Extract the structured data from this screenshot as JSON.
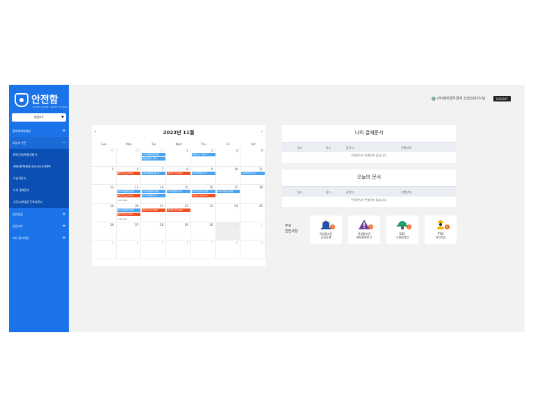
{
  "app": {
    "name": "안전함",
    "tagline": "SAFETY HOUSE · SAFETY SYSTEM"
  },
  "site_select": {
    "value": "현장A-1"
  },
  "header": {
    "user": "(주)정비결우결계 신성민(615)님",
    "logout": "LOGOUT"
  },
  "sidebar": {
    "items": [
      {
        "label": "중대재해처벌법"
      },
      {
        "label": "오늘의 안전"
      },
      {
        "label": "안전점검"
      },
      {
        "label": "안전교육"
      },
      {
        "label": "기타 관리사항"
      }
    ],
    "sub_items": [
      {
        "label": "DSC일일위험성평가"
      },
      {
        "label": "AI현대P위해재 체크리스트/OPS"
      },
      {
        "label": "오늘의문서"
      },
      {
        "label": "나의 결재문서"
      },
      {
        "label": "신규/고위험군근로자관리"
      }
    ]
  },
  "calendar": {
    "title": "2023년 11월",
    "prev": "‹",
    "next": "›",
    "weekdays": [
      "Sun",
      "Mon",
      "Tue",
      "Wed",
      "Thu",
      "Fri",
      "Sat"
    ],
    "weeks": [
      {
        "days": [
          [
            "29",
            "m"
          ],
          [
            "30",
            "m"
          ],
          [
            "31",
            "m"
          ],
          [
            "1",
            ""
          ],
          [
            "2",
            ""
          ],
          [
            "3",
            ""
          ],
          [
            "4",
            ""
          ]
        ]
      },
      {
        "days": [
          [
            "5",
            ""
          ],
          [
            "6",
            ""
          ],
          [
            "7",
            ""
          ],
          [
            "8",
            ""
          ],
          [
            "9",
            ""
          ],
          [
            "10",
            ""
          ],
          [
            "11",
            ""
          ]
        ]
      },
      {
        "days": [
          [
            "12",
            ""
          ],
          [
            "13",
            ""
          ],
          [
            "14",
            ""
          ],
          [
            "15",
            ""
          ],
          [
            "16",
            ""
          ],
          [
            "17",
            ""
          ],
          [
            "18",
            ""
          ]
        ]
      },
      {
        "days": [
          [
            "19",
            ""
          ],
          [
            "20",
            ""
          ],
          [
            "21",
            ""
          ],
          [
            "22",
            ""
          ],
          [
            "23",
            ""
          ],
          [
            "24",
            ""
          ],
          [
            "25",
            ""
          ]
        ]
      },
      {
        "days": [
          [
            "26",
            ""
          ],
          [
            "27",
            ""
          ],
          [
            "28",
            ""
          ],
          [
            "29",
            ""
          ],
          [
            "30",
            ""
          ],
          [
            "1",
            "m"
          ],
          [
            "2",
            "m"
          ]
        ]
      },
      {
        "days": [
          [
            "3",
            "m"
          ],
          [
            "4",
            "m"
          ],
          [
            "5",
            "m"
          ],
          [
            "6",
            "m"
          ],
          [
            "7",
            "m"
          ],
          [
            "8",
            "m"
          ],
          [
            "9",
            "m"
          ]
        ]
      }
    ],
    "today_label": "1",
    "events": [
      {
        "label": "DSC일일위험성평",
        "color": "blue",
        "week": 0,
        "day": 2,
        "slot": 0
      },
      {
        "label": "위험성평가 회의",
        "color": "blue",
        "week": 0,
        "day": 2,
        "slot": 1
      },
      {
        "label": "위험요소 작업허가",
        "color": "blue",
        "week": 0,
        "day": 4,
        "slot": 0
      },
      {
        "label": "체크리스트(OPS)",
        "color": "red",
        "week": 1,
        "day": 1,
        "slot": 0
      },
      {
        "label": "TBM위험성 평가서",
        "color": "blue",
        "week": 1,
        "day": 2,
        "slot": 0
      },
      {
        "label": "체크리스트(OPS)",
        "color": "red",
        "week": 1,
        "day": 3,
        "slot": 0
      },
      {
        "label": "PTW작업허가서",
        "color": "blue",
        "week": 1,
        "day": 4,
        "slot": 0
      },
      {
        "label": "PTW작업허가서",
        "color": "blue",
        "week": 1,
        "day": 6,
        "slot": 0
      },
      {
        "label": "DSC일일위험성평",
        "color": "blue",
        "week": 2,
        "day": 1,
        "slot": 0
      },
      {
        "label": "체크리스트(OPS)",
        "color": "red",
        "week": 2,
        "day": 1,
        "slot": 1
      },
      {
        "label": "DSC일일위험성평",
        "color": "blue",
        "week": 2,
        "day": 2,
        "slot": 0
      },
      {
        "label": "PTW작업허가서",
        "color": "blue",
        "week": 2,
        "day": 2,
        "slot": 1
      },
      {
        "label": "PTW작업허가서",
        "color": "blue",
        "week": 2,
        "day": 3,
        "slot": 0
      },
      {
        "label": "DSC일일위험성평",
        "color": "blue",
        "week": 2,
        "day": 4,
        "slot": 0
      },
      {
        "label": "체크리스트(OPS)",
        "color": "red",
        "week": 2,
        "day": 4,
        "slot": 1
      },
      {
        "label": "DSC일일위험성평",
        "color": "blue",
        "week": 2,
        "day": 5,
        "slot": 0
      },
      {
        "label": "DSC일일위험성평",
        "color": "blue",
        "week": 3,
        "day": 1,
        "slot": 0
      },
      {
        "label": "체크리스트(OPS)",
        "color": "red",
        "week": 3,
        "day": 1,
        "slot": 1
      },
      {
        "label": "체크리스트(OPS)",
        "color": "red",
        "week": 3,
        "day": 2,
        "slot": 0
      },
      {
        "label": "체크리스트(OPS)",
        "color": "red",
        "week": 3,
        "day": 3,
        "slot": 0
      }
    ],
    "more": [
      {
        "label": "+1 more",
        "week": 2,
        "day": 1
      },
      {
        "label": "+1 more",
        "week": 3,
        "day": 1
      }
    ]
  },
  "my_approval": {
    "title": "나의 결재문서",
    "columns": [
      "일시",
      "장소",
      "참정자",
      "진행상태"
    ],
    "empty": "전자문서가 존재하지 않습니다."
  },
  "today_docs": {
    "title": "오늘의 문서",
    "columns": [
      "일시",
      "장소",
      "참정자",
      "진행상태"
    ],
    "empty": "전자문서가 존재하지 않습니다."
  },
  "safety": {
    "label": "주요\n안전사항",
    "items": [
      {
        "label": "작업중지권\n공감사례",
        "badge": "0",
        "icon": "alarm-light-icon"
      },
      {
        "label": "작업중지권\n현장위험보고",
        "badge": "0",
        "icon": "warning-icon"
      },
      {
        "label": "DSC\n고위험작업",
        "badge": "0",
        "icon": "hard-hat-icon"
      },
      {
        "label": "PTW\n허가작업",
        "badge": "0",
        "icon": "worker-icon"
      }
    ]
  },
  "colors": {
    "sidebar": "#1a73e8",
    "event_blue": "#4aa3f0",
    "event_red": "#f04e23",
    "badge": "#f26522"
  }
}
